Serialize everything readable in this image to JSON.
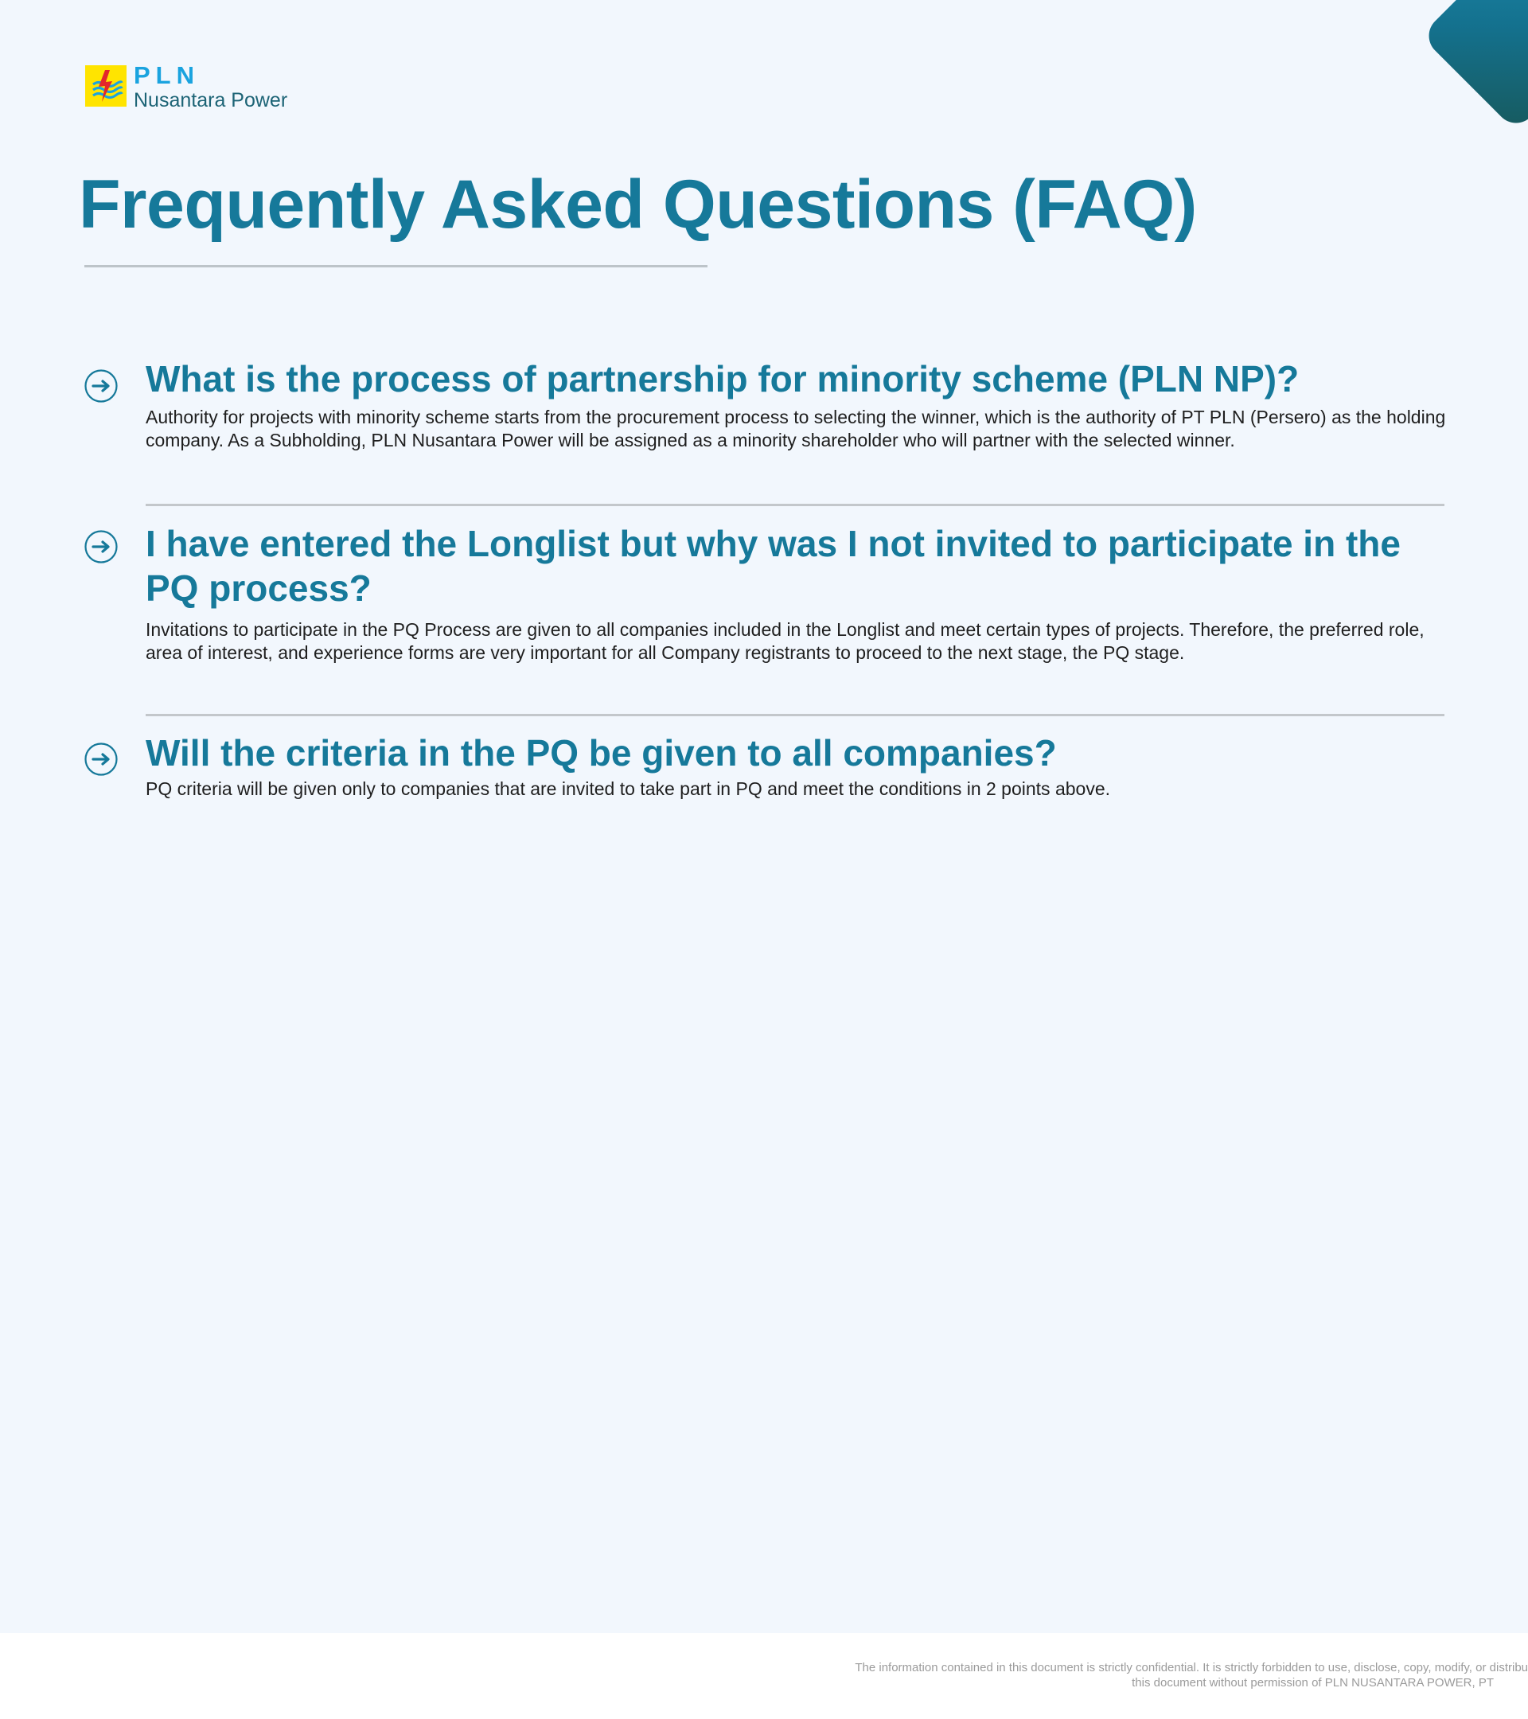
{
  "brand": {
    "name": "PLN",
    "subtitle": "Nusantara Power"
  },
  "page": {
    "title": "Frequently Asked Questions (FAQ)"
  },
  "faq": [
    {
      "question": "What is the process of partnership for minority scheme (PLN NP)?",
      "answer": "Authority for projects with minority scheme starts from the procurement process to selecting the winner, which is the authority of PT PLN (Persero) as the holding company. As a Subholding, PLN Nusantara Power will be assigned as a minority shareholder who will partner with the selected winner."
    },
    {
      "question": "I have entered the Longlist but why was I not invited to participate in the PQ process?",
      "answer": "Invitations to participate in the PQ Process are given to all companies included in the Longlist and meet certain types of projects. Therefore, the preferred role, area of interest, and experience forms are very important for all Company registrants to proceed to the next stage, the PQ stage."
    },
    {
      "question": "Will the criteria in the PQ be given to all companies?",
      "answer": "PQ criteria will be given only to companies that are invited to take part in PQ and meet the conditions in 2 points above."
    }
  ],
  "footer": {
    "line1": "The information contained in this document is strictly confidential. It is strictly forbidden to use, disclose, copy, modify, or distribu",
    "line2": "this document without permission of PLN NUSANTARA POWER, PT"
  },
  "colors": {
    "accent": "#16799a",
    "brand_blue": "#1aa3df",
    "logo_yellow": "#ffe400",
    "background": "#f2f7fd"
  },
  "icons": {
    "faq_bullet": "arrow-right-circle-icon",
    "logo": "pln-lightning-logo"
  }
}
